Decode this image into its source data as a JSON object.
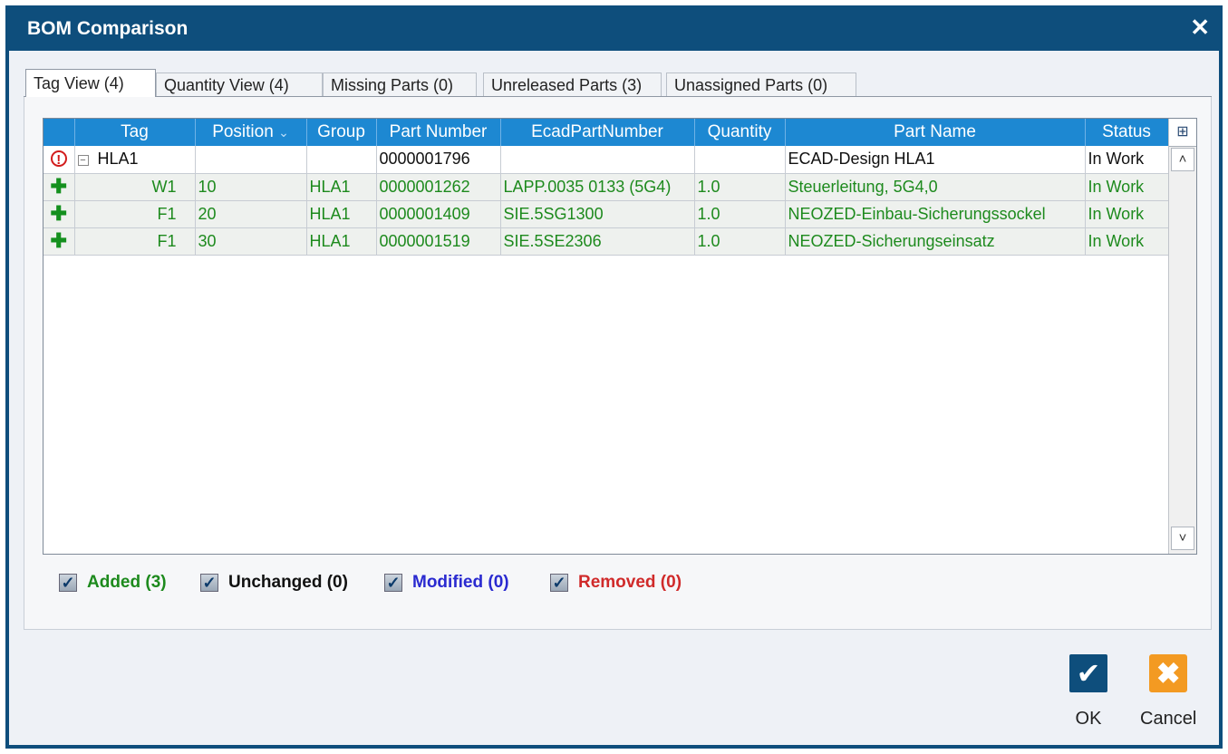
{
  "window": {
    "title": "BOM Comparison",
    "close_glyph": "✕"
  },
  "tabs": [
    {
      "label": "Tag View (4)"
    },
    {
      "label": "Quantity View (4)"
    },
    {
      "label": "Missing Parts (0)"
    },
    {
      "label": "Unreleased Parts (3)"
    },
    {
      "label": "Unassigned Parts (0)"
    }
  ],
  "grid": {
    "columns": {
      "tag": "Tag",
      "position": "Position",
      "group": "Group",
      "part_number": "Part Number",
      "ecad_part_number": "EcadPartNumber",
      "quantity": "Quantity",
      "part_name": "Part Name",
      "status": "Status"
    },
    "sort_indicator": "⌄",
    "rows": [
      {
        "state": "modified-error",
        "tag": "HLA1",
        "position": "",
        "group": "",
        "part_number": "0000001796",
        "ecad_part_number": "",
        "quantity": "",
        "part_name": "ECAD-Design HLA1",
        "status": "In Work"
      },
      {
        "state": "added",
        "tag": "W1",
        "position": "10",
        "group": "HLA1",
        "part_number": "0000001262",
        "ecad_part_number": "LAPP.0035 0133 (5G4)",
        "quantity": "1.0",
        "part_name": "Steuerleitung, 5G4,0",
        "status": "In Work"
      },
      {
        "state": "added",
        "tag": "F1",
        "position": "20",
        "group": "HLA1",
        "part_number": "0000001409",
        "ecad_part_number": "SIE.5SG1300",
        "quantity": "1.0",
        "part_name": "NEOZED-Einbau-Sicherungssockel",
        "status": "In Work"
      },
      {
        "state": "added",
        "tag": "F1",
        "position": "30",
        "group": "HLA1",
        "part_number": "0000001519",
        "ecad_part_number": "SIE.5SE2306",
        "quantity": "1.0",
        "part_name": "NEOZED-Sicherungseinsatz",
        "status": "In Work"
      }
    ]
  },
  "legend": {
    "added": {
      "label": "Added (3)",
      "color": "#1d8a1d",
      "checked": true
    },
    "unchanged": {
      "label": "Unchanged (0)",
      "color": "#111111",
      "checked": true
    },
    "modified": {
      "label": "Modified (0)",
      "color": "#2a2ad0",
      "checked": true
    },
    "removed": {
      "label": "Removed (0)",
      "color": "#d02a2a",
      "checked": true
    }
  },
  "buttons": {
    "ok_label": "OK",
    "cancel_label": "Cancel"
  },
  "icons": {
    "error": "!",
    "added": "✚",
    "expander": "−",
    "check": "✓",
    "column_chooser": "⊞",
    "scroll_up": "˄",
    "scroll_down": "˅",
    "ok": "✔",
    "cancel": "✖"
  }
}
